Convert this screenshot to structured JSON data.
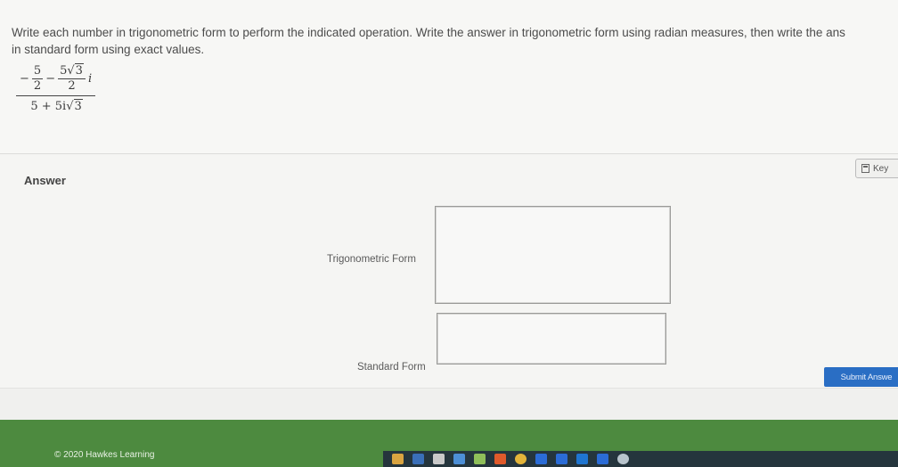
{
  "question": {
    "line1": "Write each number in trigonometric form to perform the indicated operation.  Write the answer in trigonometric form using radian measures, then write the ans",
    "line2": "in standard form using exact values.",
    "expression": {
      "sign": "−",
      "term1_num": "5",
      "term1_den": "2",
      "minus": "−",
      "term2_num_coef": "5",
      "term2_radicand": "3",
      "term2_den": "2",
      "imag_unit": "i",
      "denominator_text": "5 + 5i",
      "denominator_radicand": "3"
    }
  },
  "answer": {
    "label": "Answer",
    "key_button": "Key",
    "fields": [
      {
        "label": "Trigonometric Form",
        "value": ""
      },
      {
        "label": "Standard Form",
        "value": ""
      }
    ],
    "submit_button": "Submit Answe"
  },
  "footer": {
    "copyright": "© 2020 Hawkes Learning"
  },
  "colors": {
    "footer_green": "#4d8a3f",
    "submit_blue": "#2a6ec4",
    "taskbar": "#25353d"
  },
  "taskbar_icons": [
    "file-explorer-icon",
    "store-icon",
    "amazon-icon",
    "dropbox-icon",
    "dollar-icon",
    "office-icon",
    "chrome-icon",
    "word-icon",
    "word-icon-2",
    "outlook-icon",
    "word-icon-3",
    "notification-icon"
  ]
}
